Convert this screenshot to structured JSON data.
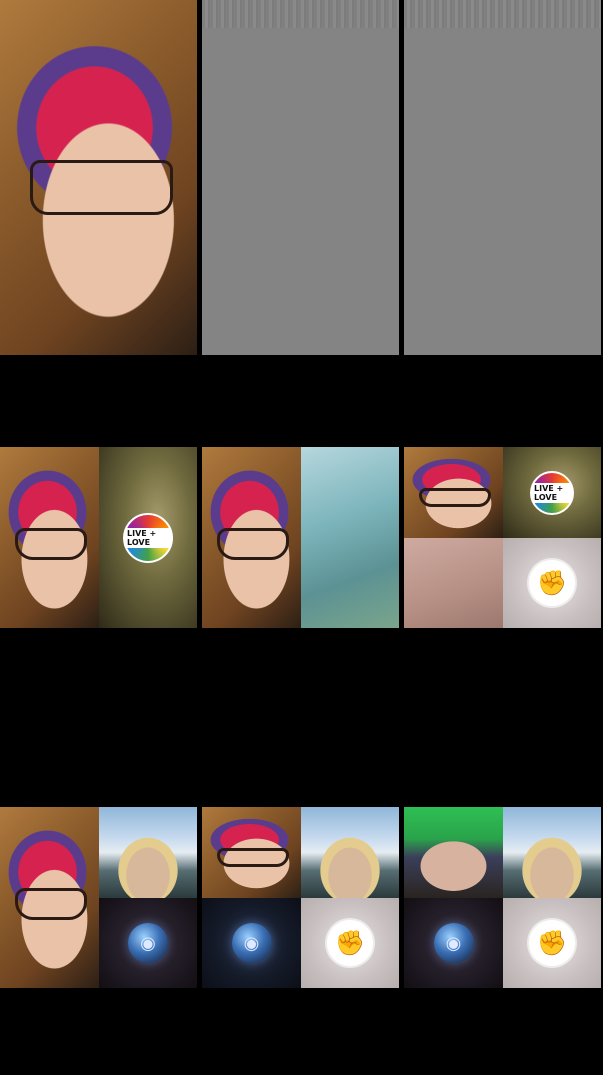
{
  "grid": {
    "participants_row1": 3,
    "participants_row2": 3,
    "participants_row3": 3
  },
  "badges": {
    "love_badge_text": "LIVE + LOVE",
    "fist_icon": "fist-icon",
    "globe_icon": "globe-icon",
    "love_icon": "love-badge-icon"
  },
  "colors": {
    "background": "#000000",
    "placeholder_gray": "#848484",
    "accent_pink": "#d6224f",
    "accent_purple": "#5b3c8c"
  }
}
